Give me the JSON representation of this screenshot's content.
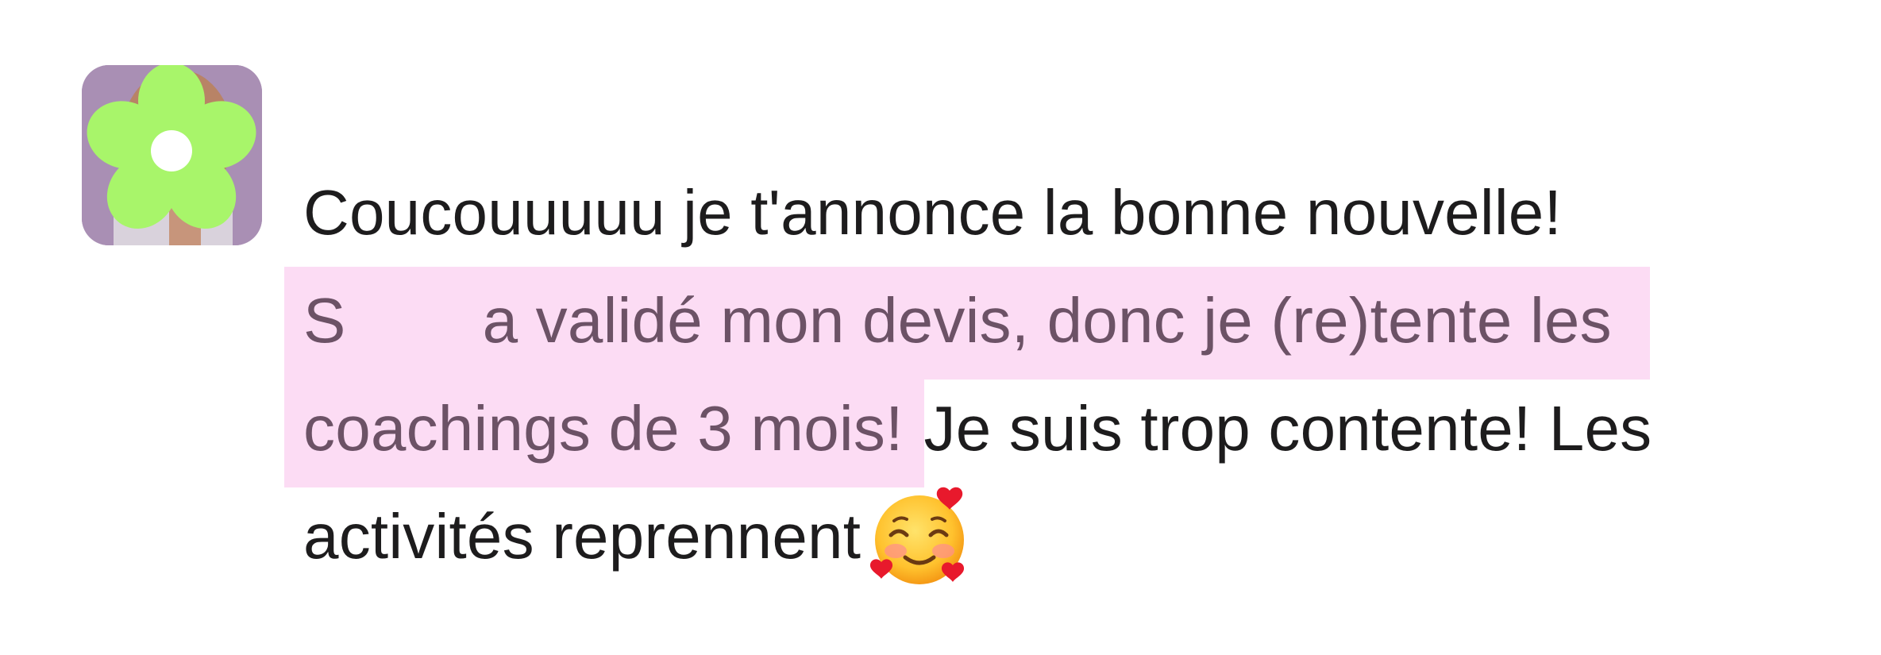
{
  "message": {
    "line1": "Coucouuuuu je t'annonce la bonne nouvelle!",
    "line2_part1": "S",
    "line2_part2": "a validé mon devis, donc je (re)tente les",
    "line3_highlighted": "coachings de 3 mois!",
    "line3_rest": "Je suis trop contente! Les",
    "line4": "activités reprennent",
    "emoji_icon": "smiling-face-with-hearts-icon"
  },
  "colors": {
    "text": "#1d1c1d",
    "highlight_bg": "#fcdcf4",
    "highlight_text": "#6c5266",
    "avatar_bg": "#a98fb4",
    "flower": "#a8f56a"
  }
}
